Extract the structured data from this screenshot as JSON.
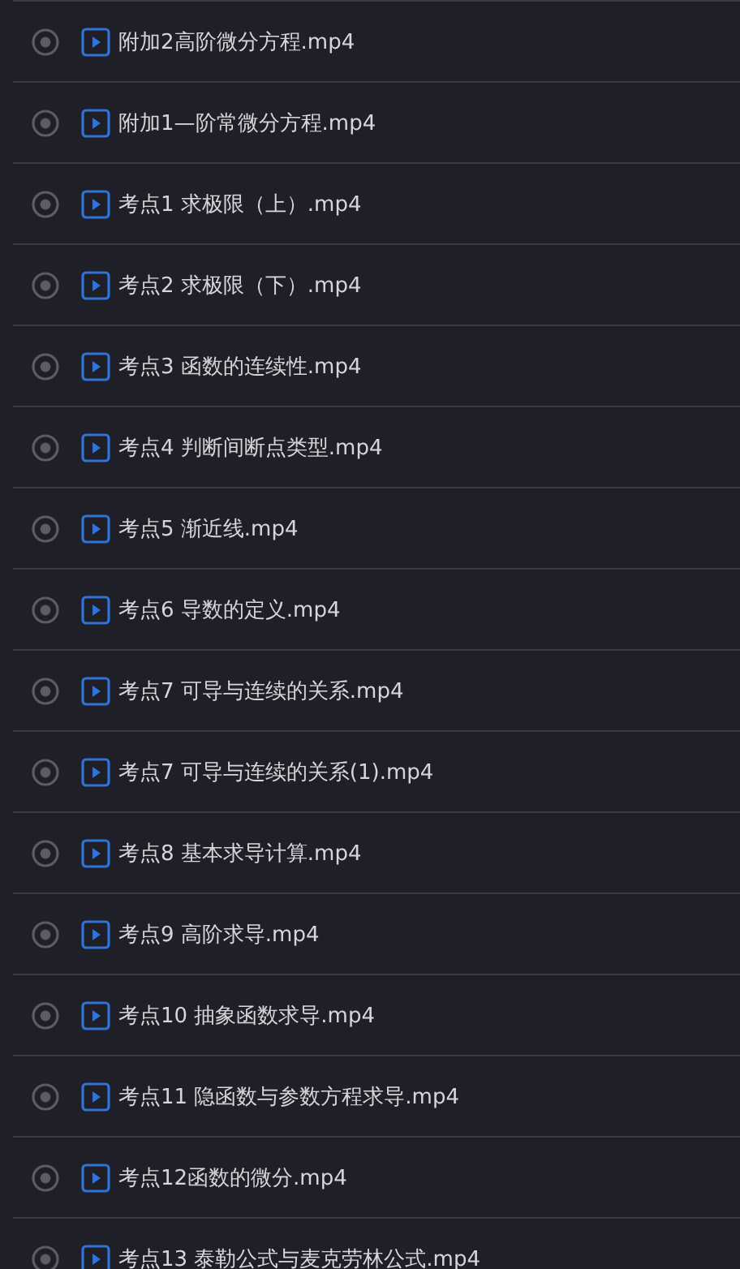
{
  "files": [
    {
      "name": "附加2高阶微分方程.mp4"
    },
    {
      "name": "附加1—阶常微分方程.mp4"
    },
    {
      "name": "考点1 求极限（上）.mp4"
    },
    {
      "name": "考点2 求极限（下）.mp4"
    },
    {
      "name": "考点3 函数的连续性.mp4"
    },
    {
      "name": "考点4 判断间断点类型.mp4"
    },
    {
      "name": "考点5 渐近线.mp4"
    },
    {
      "name": "考点6 导数的定义.mp4"
    },
    {
      "name": "考点7 可导与连续的关系.mp4"
    },
    {
      "name": "考点7 可导与连续的关系(1).mp4"
    },
    {
      "name": "考点8 基本求导计算.mp4"
    },
    {
      "name": "考点9 高阶求导.mp4"
    },
    {
      "name": "考点10 抽象函数求导.mp4"
    },
    {
      "name": "考点11 隐函数与参数方程求导.mp4"
    },
    {
      "name": "考点12函数的微分.mp4"
    },
    {
      "name": "考点13 泰勒公式与麦克劳林公式.mp4"
    }
  ]
}
